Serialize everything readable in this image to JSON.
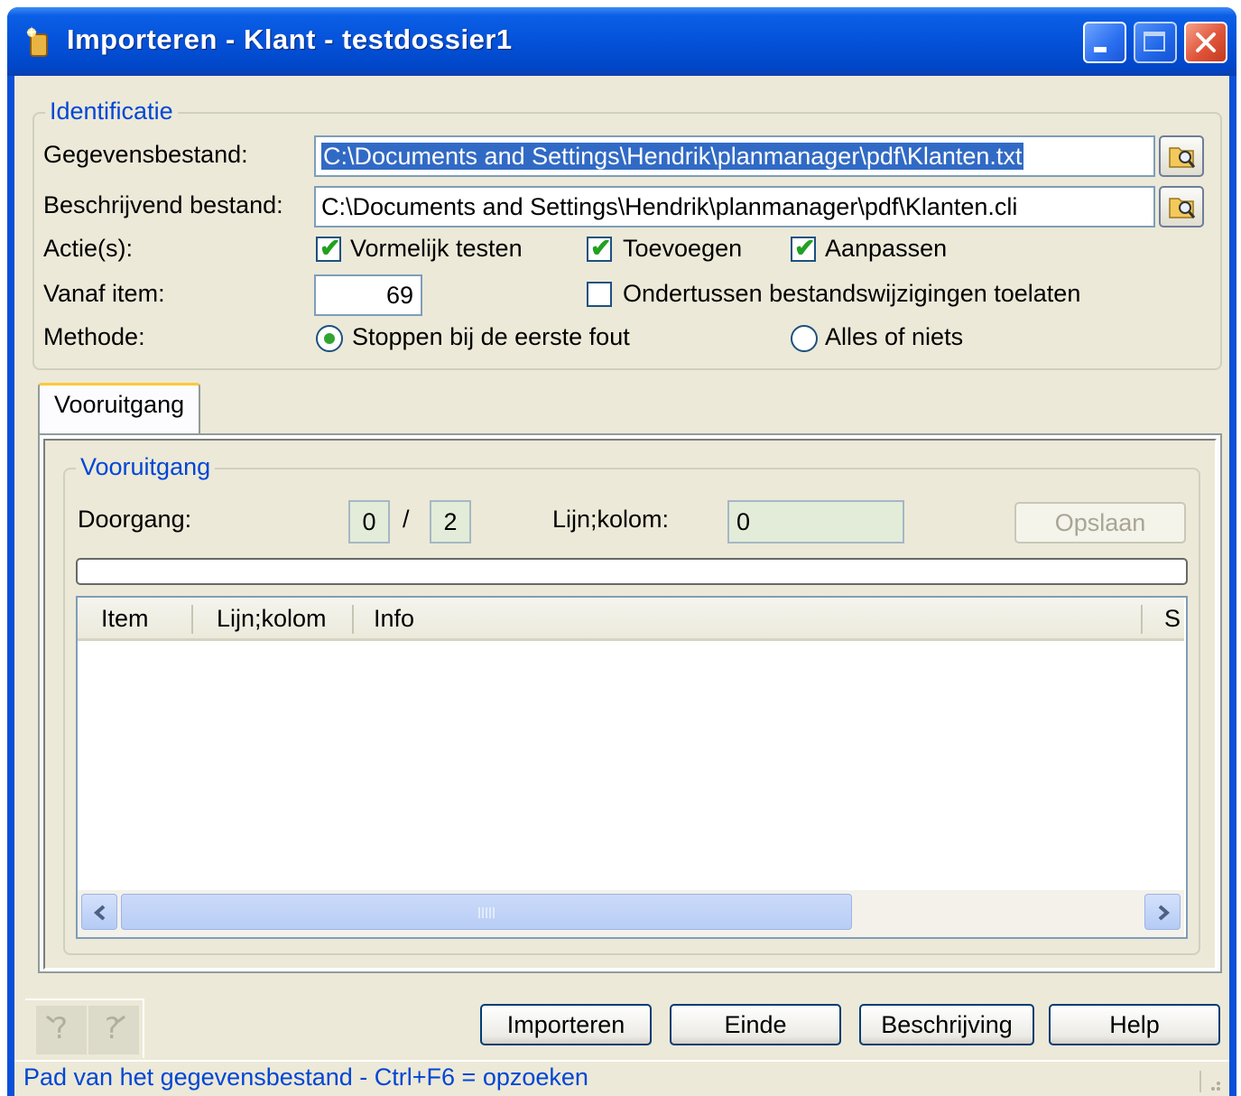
{
  "window": {
    "title": "Importeren - Klant - testdossier1",
    "icon": "import-wizard-icon"
  },
  "identificatie": {
    "legend": "Identificatie",
    "gegevensbestand_label": "Gegevensbestand:",
    "gegevensbestand_value": "C:\\Documents and Settings\\Hendrik\\planmanager\\pdf\\Klanten.txt",
    "beschrijvend_label": "Beschrijvend bestand:",
    "beschrijvend_value": "C:\\Documents and Settings\\Hendrik\\planmanager\\pdf\\Klanten.cli",
    "acties_label": "Actie(s):",
    "vormelijk_label": "Vormelijk testen",
    "vormelijk_checked": true,
    "toevoegen_label": "Toevoegen",
    "toevoegen_checked": true,
    "aanpassen_label": "Aanpassen",
    "aanpassen_checked": true,
    "vanaf_label": "Vanaf item:",
    "vanaf_value": "69",
    "ondertussen_label": "Ondertussen bestandswijzigingen toelaten",
    "ondertussen_checked": false,
    "methode_label": "Methode:",
    "stoppen_label": "Stoppen bij de eerste fout",
    "stoppen_selected": true,
    "alles_label": "Alles of niets",
    "alles_selected": false
  },
  "tabs": [
    {
      "label": "Vooruitgang",
      "active": true
    }
  ],
  "vooruitgang": {
    "legend": "Vooruitgang",
    "doorgang_label": "Doorgang:",
    "doorgang_current": "0",
    "separator": "/",
    "doorgang_total": "2",
    "lijnkolom_label": "Lijn;kolom:",
    "lijnkolom_value": "0",
    "opslaan_label": "Opslaan",
    "progress": 0,
    "columns": [
      "Item",
      "Lijn;kolom",
      "Info",
      "S"
    ]
  },
  "footer": {
    "importeren": "Importeren",
    "einde": "Einde",
    "beschrijving": "Beschrijving",
    "help": "Help"
  },
  "status": {
    "text": "Pad van het gegevensbestand - Ctrl+F6 = opzoeken"
  }
}
